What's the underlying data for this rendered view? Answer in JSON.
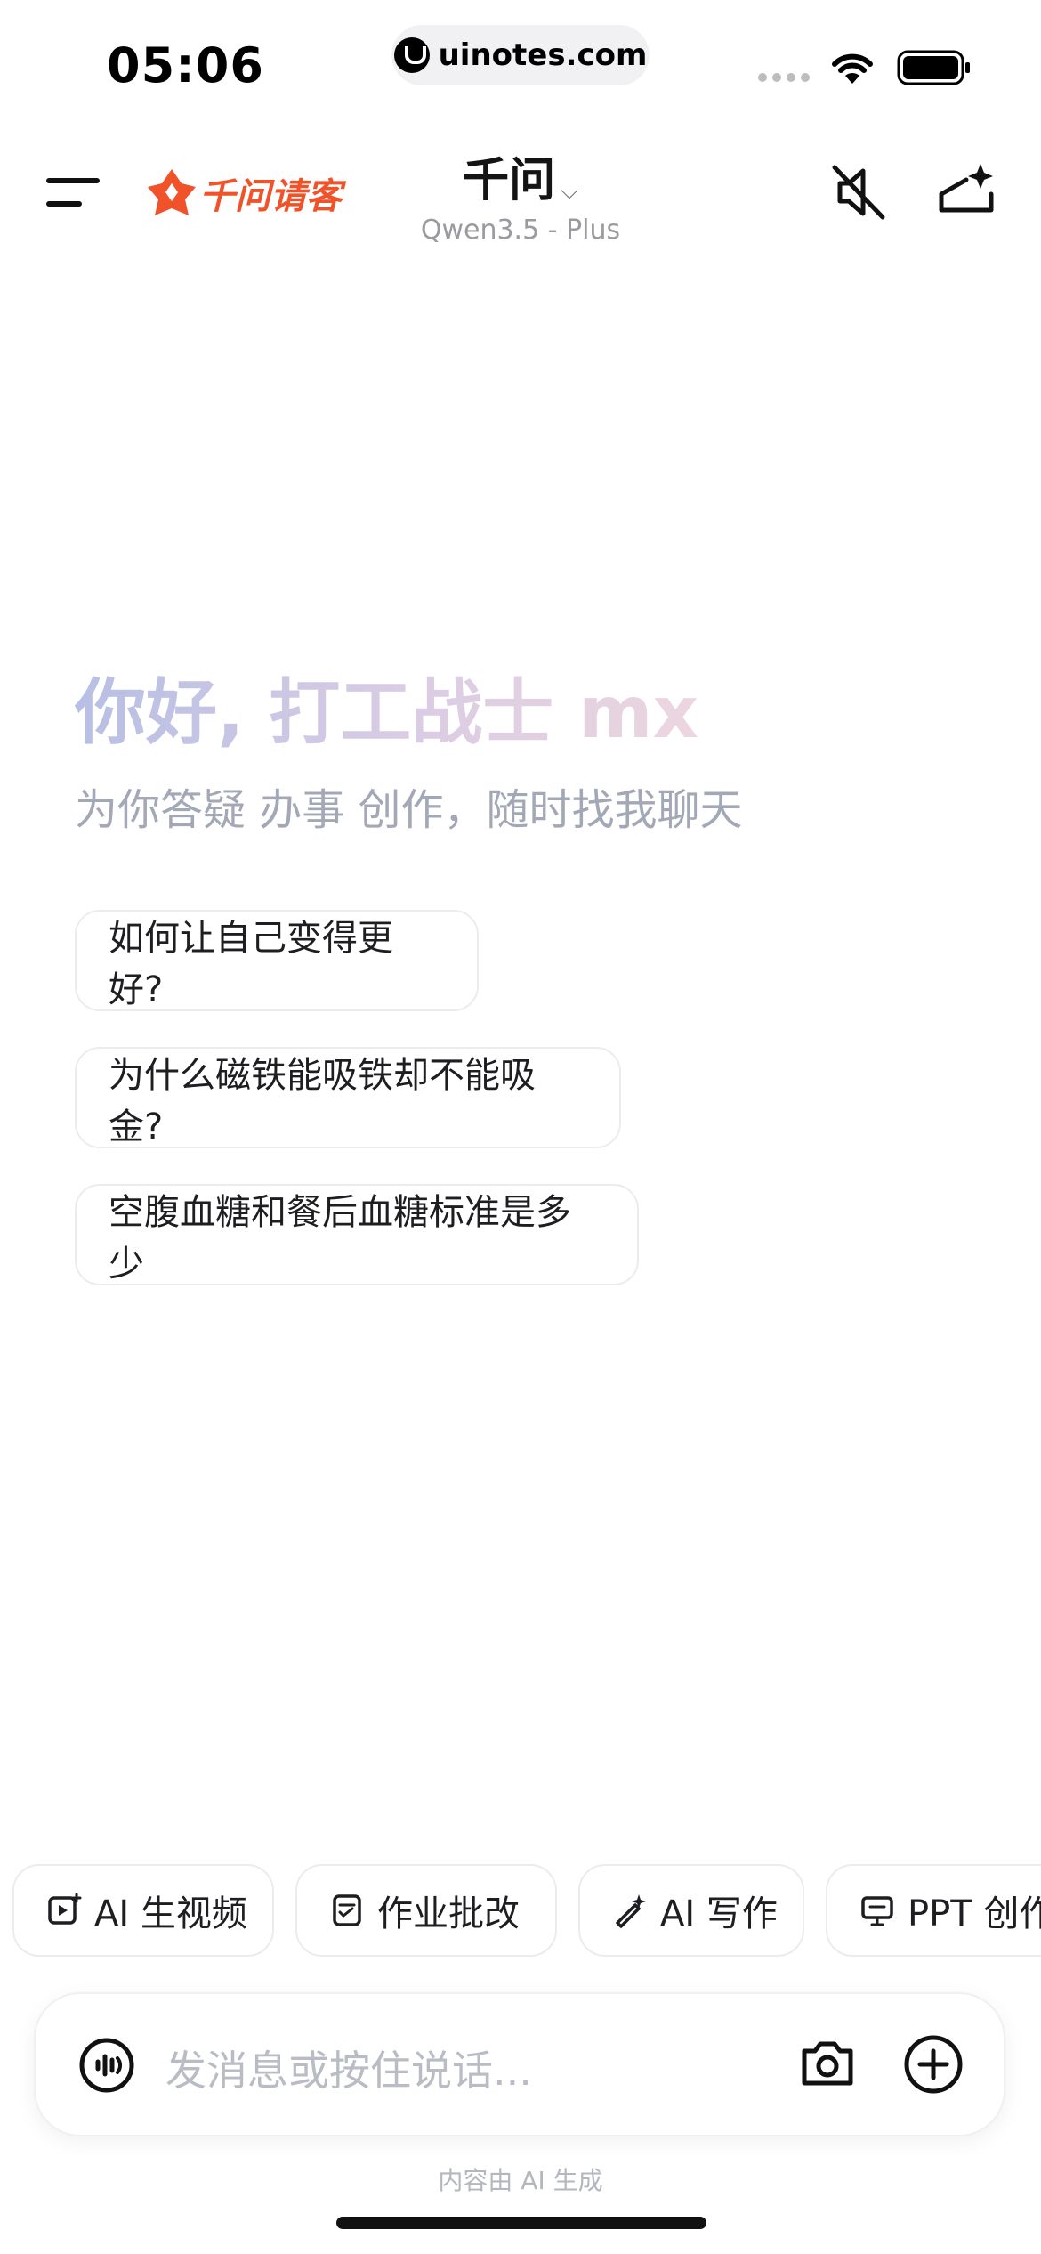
{
  "status_bar": {
    "time": "05:06",
    "url": "uinotes.com"
  },
  "header": {
    "logo_text": "千问请客",
    "title": "千问",
    "model": "Qwen3.5 - Plus"
  },
  "greeting": {
    "hello": "你好, 打工战士 mx",
    "subtitle": "为你答疑 办事 创作，随时找我聊天"
  },
  "suggestions": [
    {
      "label": "如何让自己变得更好?"
    },
    {
      "label": "为什么磁铁能吸铁却不能吸金?"
    },
    {
      "label": "空腹血糖和餐后血糖标准是多少"
    }
  ],
  "tools": [
    {
      "label": "AI 生视频",
      "icon": "video-plus-icon"
    },
    {
      "label": "作业批改",
      "icon": "homework-icon"
    },
    {
      "label": "AI 写作",
      "icon": "magic-pen-icon"
    },
    {
      "label": "PPT 创作",
      "icon": "presentation-icon"
    }
  ],
  "input": {
    "placeholder": "发消息或按住说话..."
  },
  "footer": "内容由 AI 生成",
  "colors": {
    "brand": "#f0532a",
    "greeting_start": "#b7bfe4",
    "greeting_end": "#ecd6df"
  }
}
